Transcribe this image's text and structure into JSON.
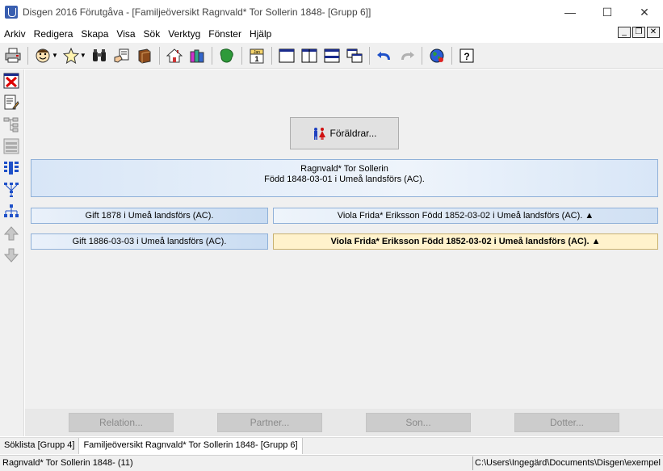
{
  "window": {
    "title": "Disgen 2016 Förutgåva - [Familjeöversikt Ragnvald* Tor Sollerin 1848- [Grupp 6]]",
    "controls": {
      "minimize": "—",
      "maximize": "☐",
      "close": "✕"
    }
  },
  "menu": {
    "items": [
      "Arkiv",
      "Redigera",
      "Skapa",
      "Visa",
      "Sök",
      "Verktyg",
      "Fönster",
      "Hjälp"
    ],
    "mdi_controls": {
      "minimize": "_",
      "restore": "❐",
      "close": "✕"
    }
  },
  "toolbar": {
    "icons": [
      "printer-icon",
      "person-icon",
      "favorite-person-icon",
      "binoculars-icon",
      "notes-hand-icon",
      "book-icon",
      "home-icon",
      "books-icon",
      "map-icon",
      "calendar-icon",
      "layout-single-icon",
      "layout-columns-icon",
      "layout-rows-icon",
      "layout-cascade-icon",
      "undo-icon",
      "redo-icon",
      "globe-icon",
      "help-icon"
    ],
    "calendar_label": "Jan"
  },
  "sidebar": {
    "icons": [
      "delete-icon",
      "edit-icon",
      "tree-icon",
      "group-sheet-icon",
      "columns-icon",
      "descendants-icon",
      "hierarchy-icon",
      "up-arrow-icon",
      "down-arrow-icon"
    ]
  },
  "family": {
    "parents_button": "Föräldrar...",
    "person_name": "Ragnvald* Tor Sollerin",
    "person_birth": "Född 1848-03-01 i Umeå landsförs (AC).",
    "marriages": [
      {
        "event": "Gift 1878 i Umeå landsförs (AC).",
        "spouse": "Viola Frida* Eriksson Född 1852-03-02 i Umeå landsförs (AC). ▲"
      },
      {
        "event": "Gift 1886-03-03 i Umeå landsförs (AC).",
        "spouse": "Viola Frida* Eriksson Född 1852-03-02 i Umeå landsförs (AC). ▲"
      }
    ]
  },
  "bottom_buttons": {
    "relation": "Relation...",
    "partner": "Partner...",
    "son": "Son...",
    "daughter": "Dotter..."
  },
  "tabs": [
    "Söklista [Grupp 4]",
    "Familjeöversikt Ragnvald* Tor Sollerin 1848- [Grupp 6]"
  ],
  "status": {
    "left": "Ragnvald* Tor Sollerin 1848- (11)",
    "right": "C:\\Users\\Ingegärd\\Documents\\Disgen\\exempel"
  },
  "colors": {
    "accent_blue": "#3a5fb0",
    "box_border": "#8fb0d8",
    "active_spouse_bg": "#fff2cc"
  }
}
